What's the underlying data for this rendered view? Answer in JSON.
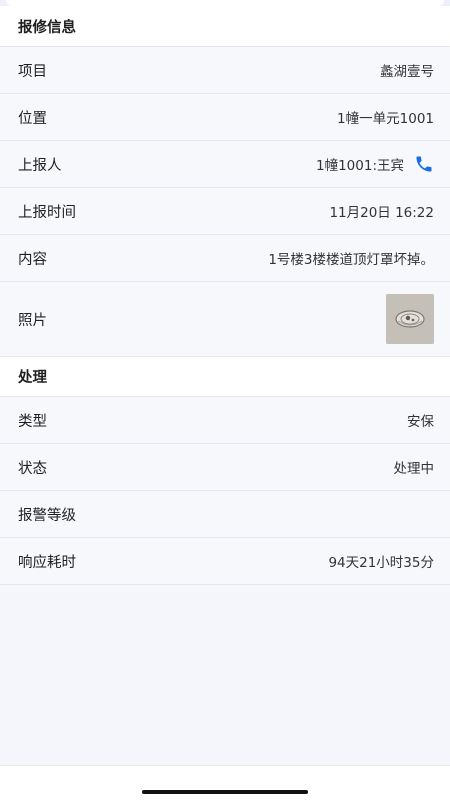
{
  "colors": {
    "page_background": "#f4f6fb",
    "row_background": "#f7f8fc",
    "header_background": "#ffffff",
    "accent": "#1a6ce8",
    "divider": "#e3e6ee"
  },
  "repair_info": {
    "section_title": "报修信息",
    "project": {
      "label": "项目",
      "value": "蠡湖壹号"
    },
    "location": {
      "label": "位置",
      "value": "1幢一单元1001"
    },
    "reporter": {
      "label": "上报人",
      "value": "1幢1001:王宾",
      "icon": "phone-icon"
    },
    "report_time": {
      "label": "上报时间",
      "value": "11月20日 16:22"
    },
    "content": {
      "label": "内容",
      "value": "1号楼3楼楼道顶灯罩坏掉。"
    },
    "photo": {
      "label": "照片",
      "icon": "photo-thumbnail"
    }
  },
  "processing": {
    "section_title": "处理",
    "type": {
      "label": "类型",
      "value": "安保"
    },
    "status": {
      "label": "状态",
      "value": "处理中"
    },
    "alarm_level": {
      "label": "报警等级",
      "value": ""
    },
    "response_time": {
      "label": "响应耗时",
      "value": "94天21小时35分"
    }
  }
}
